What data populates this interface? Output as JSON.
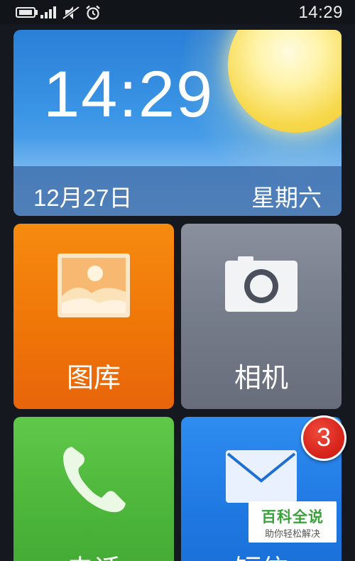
{
  "status_bar": {
    "time": "14:29",
    "icons": [
      "battery-icon",
      "signal-icon",
      "mute-icon",
      "alarm-icon"
    ]
  },
  "clock_widget": {
    "time": "14:29",
    "date": "12月27日",
    "weekday": "星期六",
    "weather_icon": "sun-icon"
  },
  "tiles": {
    "gallery": {
      "label": "图库",
      "icon": "gallery-icon",
      "color": "#ef7608"
    },
    "camera": {
      "label": "相机",
      "icon": "camera-icon",
      "color": "#737a88"
    },
    "phone": {
      "label": "电话",
      "icon": "phone-icon",
      "color": "#4cb53a"
    },
    "sms": {
      "label": "短信",
      "icon": "envelope-icon",
      "color": "#1f79e2",
      "badge": "3"
    }
  },
  "watermark": {
    "title": "百科全说",
    "subtitle": "助你轻松解决"
  }
}
